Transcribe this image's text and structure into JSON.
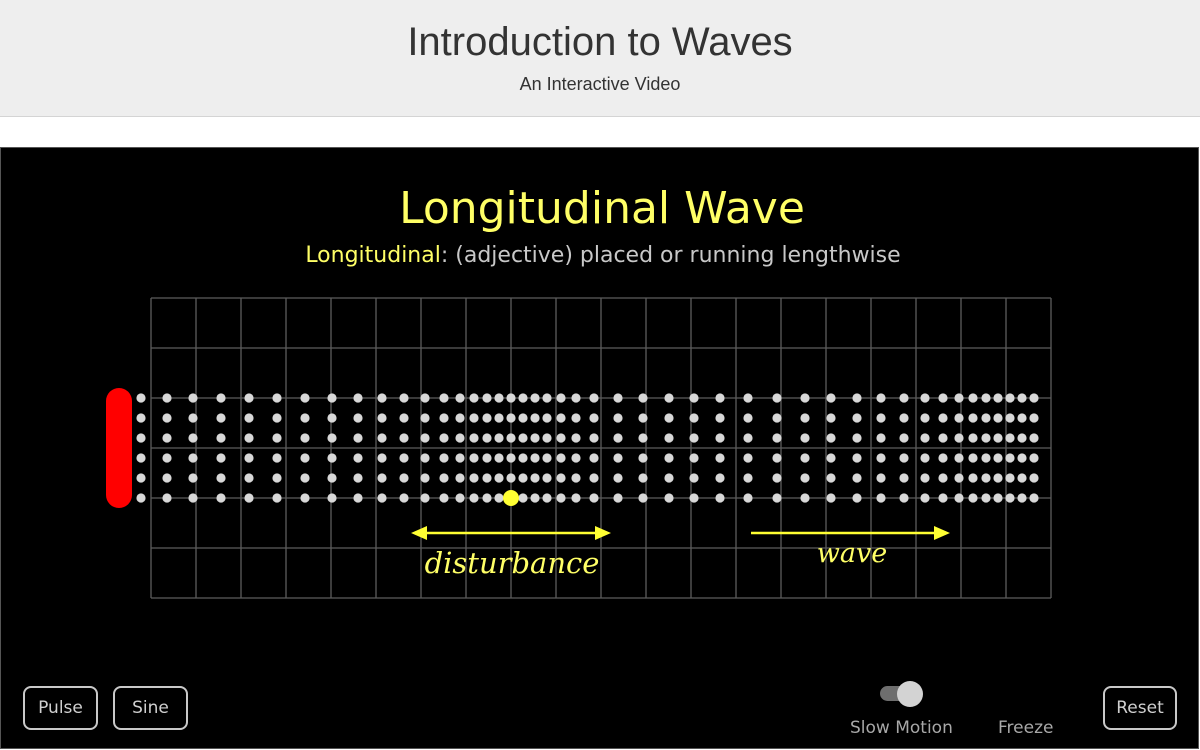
{
  "header": {
    "title": "Introduction to Waves",
    "subtitle": "An Interactive Video"
  },
  "scene": {
    "title": "Longitudinal Wave",
    "definition_term": "Longitudinal",
    "definition_rest": ": (adjective) placed or running lengthwise",
    "disturbance_label": "disturbance",
    "wave_label": "wave",
    "colors": {
      "background": "#000000",
      "accent": "#ffff66",
      "particle": "#d8d8d8",
      "tracked_particle": "#ffff33",
      "driver": "#ff0000",
      "grid": "#5c5c5c"
    }
  },
  "controls": {
    "pulse_label": "Pulse",
    "sine_label": "Sine",
    "slow_motion_label": "Slow Motion",
    "slow_motion_on": true,
    "freeze_label": "Freeze",
    "reset_label": "Reset"
  }
}
